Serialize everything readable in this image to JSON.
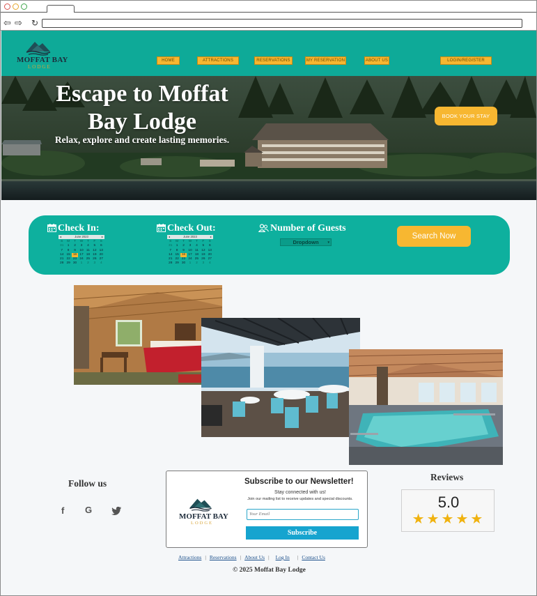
{
  "header": {
    "logo_text": "MOFFAT BAY",
    "logo_sub": "LODGE",
    "nav": [
      "HOME",
      "ATTRACTIONS",
      "RESERVATIONS",
      "MY RESERVATION",
      "ABOUT US",
      "LOGIN/REGISTER"
    ]
  },
  "hero": {
    "title": "Escape to Moffat Bay Lodge",
    "subtitle": "Relax, explore and create lasting memories.",
    "cta": "BOOK YOUR STAY"
  },
  "booking": {
    "check_in_label": "Check In:",
    "check_out_label": "Check Out:",
    "guests_label": "Number of Guests",
    "guests_dropdown": "Dropdown",
    "search_button": "Search Now",
    "calendar_month": "June 2023",
    "calendar_days": [
      "S",
      "M",
      "T",
      "W",
      "T",
      "F",
      "S"
    ],
    "calendar_weeks": [
      [
        "31",
        "1",
        "2",
        "3",
        "4",
        "5",
        "6"
      ],
      [
        "7",
        "8",
        "9",
        "10",
        "11",
        "12",
        "13"
      ],
      [
        "14",
        "15",
        "16",
        "17",
        "18",
        "19",
        "20"
      ],
      [
        "21",
        "22",
        "23",
        "24",
        "25",
        "26",
        "27"
      ],
      [
        "28",
        "29",
        "30",
        "1",
        "2",
        "3",
        "4"
      ]
    ],
    "selected_day": "16"
  },
  "footer": {
    "follow_title": "Follow us",
    "social_icons": [
      "facebook-icon",
      "google-icon",
      "twitter-icon"
    ],
    "newsletter": {
      "title": "Subscribe to our Newsletter!",
      "line1": "Stay connected with us!",
      "line2": "Join our mailing list to receive updates and special discounts.",
      "email_placeholder": "Your Email",
      "button": "Subscribe",
      "logo_text": "MOFFAT BAY",
      "logo_sub": "LODGE"
    },
    "reviews_title": "Reviews",
    "rating": "5.0",
    "stars": 5,
    "links": [
      "Attractions",
      "Reservations",
      "About Us",
      "Log In",
      "Contact Us"
    ],
    "copyright": "© 2025 Moffat Bay Lodge"
  },
  "colors": {
    "teal": "#0eaa98",
    "gold": "#f7b731",
    "newsletter_blue": "#16a4cf"
  }
}
